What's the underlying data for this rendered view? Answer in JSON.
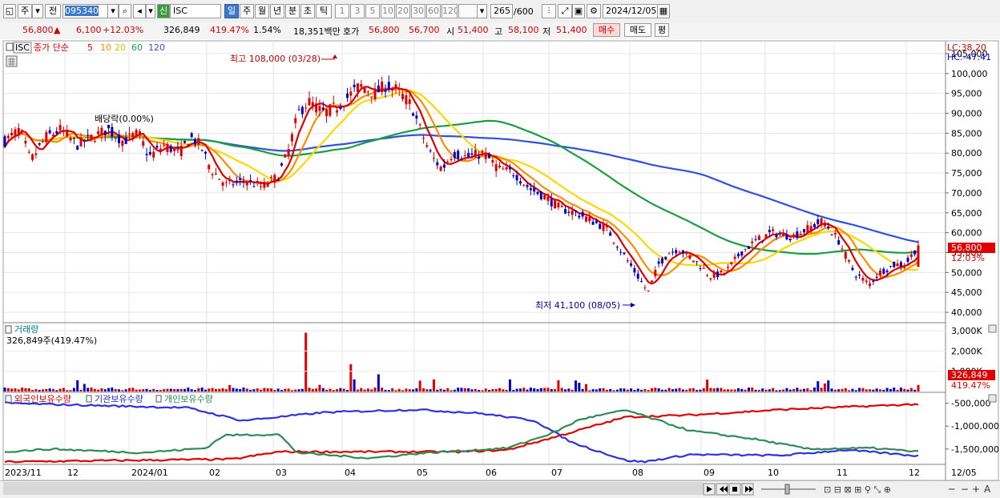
{
  "toolbar": {
    "market": "주",
    "prev": "전",
    "code": "095340",
    "name_prefix": "신",
    "name": "ISC",
    "period_tabs": [
      "일",
      "주",
      "월",
      "년",
      "분",
      "초",
      "틱"
    ],
    "interval_tabs": [
      "1",
      "3",
      "5",
      "10",
      "20",
      "30",
      "60",
      "120"
    ],
    "count": "265",
    "count_max": "/600",
    "date": "2024/12/05"
  },
  "quote": {
    "price": "56,800",
    "change": "6,100",
    "change_pct": "+12.03%",
    "volume": "326,849",
    "volume_ratio": "419.47%",
    "turnover": "1.54%",
    "amount": "18,351백만",
    "bid_label": "호가",
    "ask": "56,800",
    "bid": "56,700",
    "open_label": "시",
    "open": "51,400",
    "high_label": "고",
    "high": "58,100",
    "low_label": "저",
    "low": "51,400",
    "buy_btn": "매수",
    "sell_btn": "매도",
    "eval_btn": "평"
  },
  "price_panel": {
    "symbol": "ISC",
    "ma_title": "종가 단순",
    "ma_periods": [
      "5",
      "10",
      "20",
      "60",
      "120"
    ],
    "lc_label": "LC:38.20",
    "hc_label": "HC:-47.41",
    "annotations": {
      "high": "최고 108,000 (03/28)",
      "low": "최저 41,100 (08/05)",
      "dividend": "배당락(0.00%)"
    },
    "last_price_tag": "56,800",
    "last_change_tag": "12.03%"
  },
  "volume_panel": {
    "title": "거래량",
    "summary": "326,849주(419.47%)",
    "last_tag": "326,849",
    "ratio_tag": "419.47%"
  },
  "flow_panel": {
    "legends": [
      "외국인보유수량",
      "기관보유수량",
      "개인보유수량"
    ]
  },
  "x_axis": [
    "2023/11",
    "12",
    "2024/01",
    "02",
    "03",
    "04",
    "05",
    "06",
    "07",
    "08",
    "09",
    "10",
    "11",
    "12",
    "12/05"
  ],
  "colors": {
    "up": "#e00000",
    "down": "#0000c8",
    "ma5": "#e00000",
    "ma10": "#ff8c00",
    "ma20": "#ffd700",
    "ma60": "#18a040",
    "ma120": "#3050e0",
    "foreign": "#e00000",
    "institution": "#3030e0",
    "individual": "#2e8b57"
  },
  "chart_data": {
    "type": "candlestick",
    "date_range": [
      "2023/11",
      "2024/12/05"
    ],
    "price_axis": {
      "ylim": [
        38000,
        108000
      ],
      "ticks": [
        "105,000",
        "100,000",
        "95,000",
        "90,000",
        "85,000",
        "80,000",
        "75,000",
        "70,000",
        "65,000",
        "60,000",
        "55,000",
        "50,000",
        "45,000",
        "40,000"
      ]
    },
    "approx_close_by_month": [
      {
        "x": "2023/11",
        "close": 82000
      },
      {
        "x": "12",
        "close": 84000
      },
      {
        "x": "2024/01",
        "close": 80000
      },
      {
        "x": "02",
        "close": 73000
      },
      {
        "x": "03",
        "close": 93000
      },
      {
        "x": "04",
        "close": 95000
      },
      {
        "x": "05",
        "close": 80000
      },
      {
        "x": "06",
        "close": 72000
      },
      {
        "x": "07",
        "close": 62000
      },
      {
        "x": "08",
        "close": 46000
      },
      {
        "x": "09",
        "close": 50000
      },
      {
        "x": "10",
        "close": 60000
      },
      {
        "x": "11",
        "close": 48000
      },
      {
        "x": "12/05",
        "close": 56800
      }
    ],
    "volume_axis": {
      "ticks": [
        "3,000K",
        "2,000K",
        "1,000K"
      ]
    },
    "flow_axis": {
      "ticks": [
        "-500,000",
        "-1,000,000",
        "-1,500,000"
      ]
    }
  }
}
